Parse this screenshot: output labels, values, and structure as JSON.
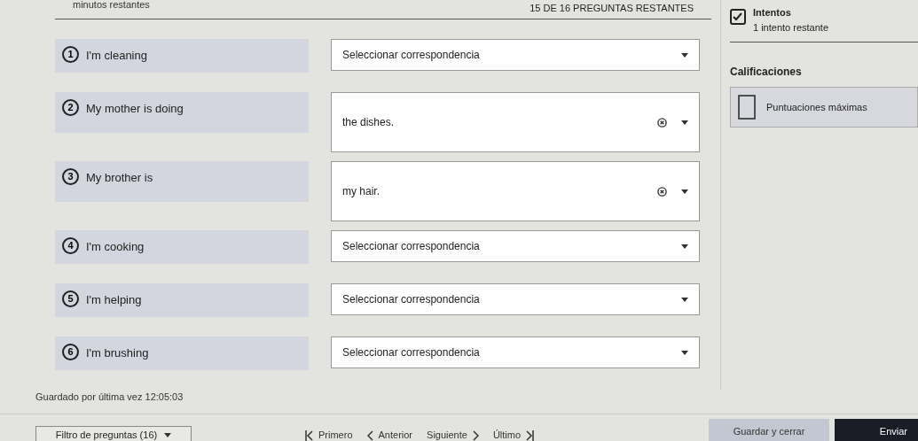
{
  "header": {
    "timer": "minutos restantes",
    "progress": "15 DE 16 PREGUNTAS RESTANTES"
  },
  "questions": [
    {
      "number": "1",
      "prompt": "I'm cleaning",
      "placeholder": "Seleccionar correspondencia"
    },
    {
      "number": "2",
      "prompt": "My mother is doing",
      "value": "the dishes."
    },
    {
      "number": "3",
      "prompt": "My brother is",
      "value": "my hair."
    },
    {
      "number": "4",
      "prompt": "I'm cooking",
      "placeholder": "Seleccionar correspondencia"
    },
    {
      "number": "5",
      "prompt": "I'm helping",
      "placeholder": "Seleccionar correspondencia"
    },
    {
      "number": "6",
      "prompt": "I'm brushing",
      "placeholder": "Seleccionar correspondencia"
    }
  ],
  "sidebar": {
    "attempts_title": "Intentos",
    "attempts_text": "1 intento restante",
    "grades_title": "Calificaciones",
    "grades_item": "Puntuaciones máximas"
  },
  "saved": "Guardado por última vez 12:05:03",
  "footer": {
    "filter": "Filtro de preguntas (16)",
    "nav": [
      "Primero",
      "Anterior",
      "Siguiente",
      "Último"
    ],
    "save_close": "Guardar y cerrar",
    "submit": "Enviar"
  }
}
